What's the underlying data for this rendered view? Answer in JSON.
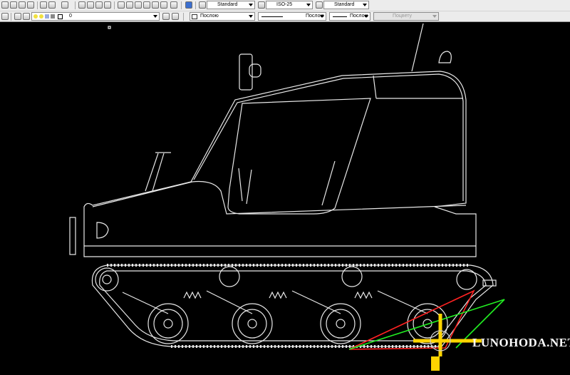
{
  "toolbar": {
    "text_style": "Standard",
    "dim_style": "ISO-25",
    "table_style": "Standard",
    "layer": "0",
    "color": "Послою",
    "linetype": "Послою",
    "lineweight": "Послою",
    "plot_style": "Поцвету"
  },
  "icons": [
    "new-icon",
    "open-icon",
    "save-icon",
    "print-icon",
    "undo-icon",
    "redo-icon",
    "pan-icon",
    "zoom-icon",
    "properties-icon",
    "help-icon",
    "layers-icon",
    "layer-state-icon",
    "text-style-icon",
    "dim-style-icon",
    "table-style-icon"
  ],
  "watermark": "LUNOHODA.NET",
  "colors": {
    "drawing_line": "#e8e8e8",
    "marker_red": "#ff2222",
    "marker_green": "#22ee22",
    "marker_yellow": "#ffd400"
  }
}
